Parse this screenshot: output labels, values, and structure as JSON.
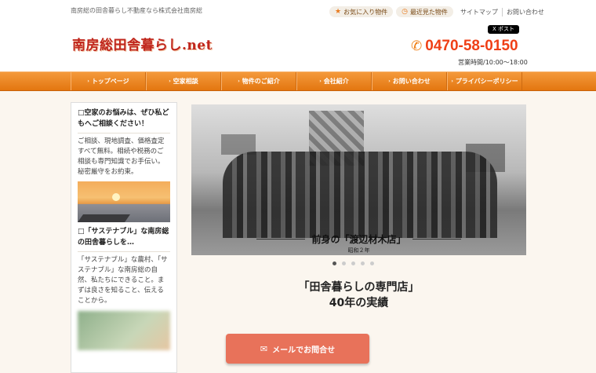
{
  "header": {
    "tagline": "南房総の田舎暮らし不動産なら株式会社南房総",
    "favorites_label": "お気に入り物件",
    "recent_label": "最近見た物件",
    "sitemap_label": "サイトマップ",
    "contact_label": "お問い合わせ",
    "logo_text": "南房総田舎暮らし.net",
    "xpost_label": "X ポスト",
    "phone": "0470-58-0150",
    "hours": "営業時間/10:00～18:00"
  },
  "nav": {
    "items": [
      {
        "label": "トップページ"
      },
      {
        "label": "空家相談"
      },
      {
        "label": "物件のご紹介"
      },
      {
        "label": "会社紹介"
      },
      {
        "label": "お問い合わせ"
      },
      {
        "label": "プライバシーポリシー"
      }
    ]
  },
  "sidebar": {
    "block1_title": "□空家のお悩みは、ぜひ私どもへご相談ください！",
    "block1_text": "ご相談、現地調査、価格査定すべて無料。相続や税務のご相談も専門知識でお手伝い。秘密厳守をお約束。",
    "block2_title": "□「サステナブル」な南房総の田舎暮らしを…",
    "block2_text": "「サステナブル」な農村、「サステナブル」な南房総の自然、私たちにできること。まずは良さを知ること、伝えることから。"
  },
  "slider": {
    "caption_main": "前身の「渡辺材木店」",
    "caption_sub": "昭和２年",
    "dot_count": 5,
    "active_dot": 1
  },
  "hero": {
    "line1": "「田舎暮らしの専門店」",
    "line2": "40年の実績"
  },
  "cta": {
    "mail_label": "メールでお問合せ"
  },
  "colors": {
    "accent": "#ef7d12",
    "phone": "#ef3f16",
    "logo": "#c0261d",
    "cta": "#e8725a"
  },
  "icons": {
    "favorites": "star-icon",
    "recent": "history-icon",
    "phone": "phone-icon",
    "mail": "mail-icon"
  }
}
